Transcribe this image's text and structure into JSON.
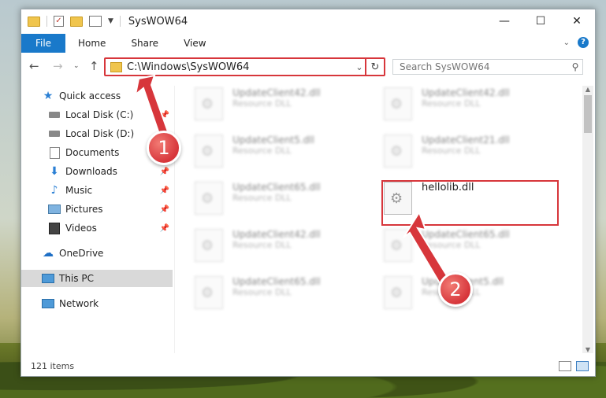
{
  "window": {
    "title": "SysWOW64"
  },
  "ribbon": {
    "file": "File",
    "home": "Home",
    "share": "Share",
    "view": "View",
    "help": "?"
  },
  "address": {
    "path": "C:\\Windows\\SysWOW64"
  },
  "search": {
    "placeholder": "Search SysWOW64"
  },
  "nav": {
    "quick_access": "Quick access",
    "local_c": "Local Disk (C:)",
    "local_d": "Local Disk (D:)",
    "documents": "Documents",
    "downloads": "Downloads",
    "music": "Music",
    "pictures": "Pictures",
    "videos": "Videos",
    "onedrive": "OneDrive",
    "this_pc": "This PC",
    "network": "Network"
  },
  "files": {
    "r1c1": {
      "name": "UpdateClient42.dll",
      "type": "Resource DLL"
    },
    "r1c2": {
      "name": "UpdateClient42.dll",
      "type": "Resource DLL"
    },
    "r2c1": {
      "name": "UpdateClient5.dll",
      "type": "Resource DLL"
    },
    "r2c2": {
      "name": "UpdateClient21.dll",
      "type": "Resource DLL"
    },
    "r3c1": {
      "name": "UpdateClient65.dll",
      "type": "Resource DLL"
    },
    "r3c2": {
      "name": "hellolib.dll",
      "type": ""
    },
    "r4c1": {
      "name": "UpdateClient42.dll",
      "type": "Resource DLL"
    },
    "r4c2": {
      "name": "UpdateClient65.dll",
      "type": "Resource DLL"
    },
    "r5c1": {
      "name": "UpdateClient65.dll",
      "type": "Resource DLL"
    },
    "r5c2": {
      "name": "UpdateClient5.dll",
      "type": "Resource DLL"
    }
  },
  "status": {
    "count": "121 items"
  },
  "annotations": {
    "badge1": "1",
    "badge2": "2"
  },
  "colors": {
    "accent": "#1979ca",
    "highlight": "#d7363b"
  }
}
